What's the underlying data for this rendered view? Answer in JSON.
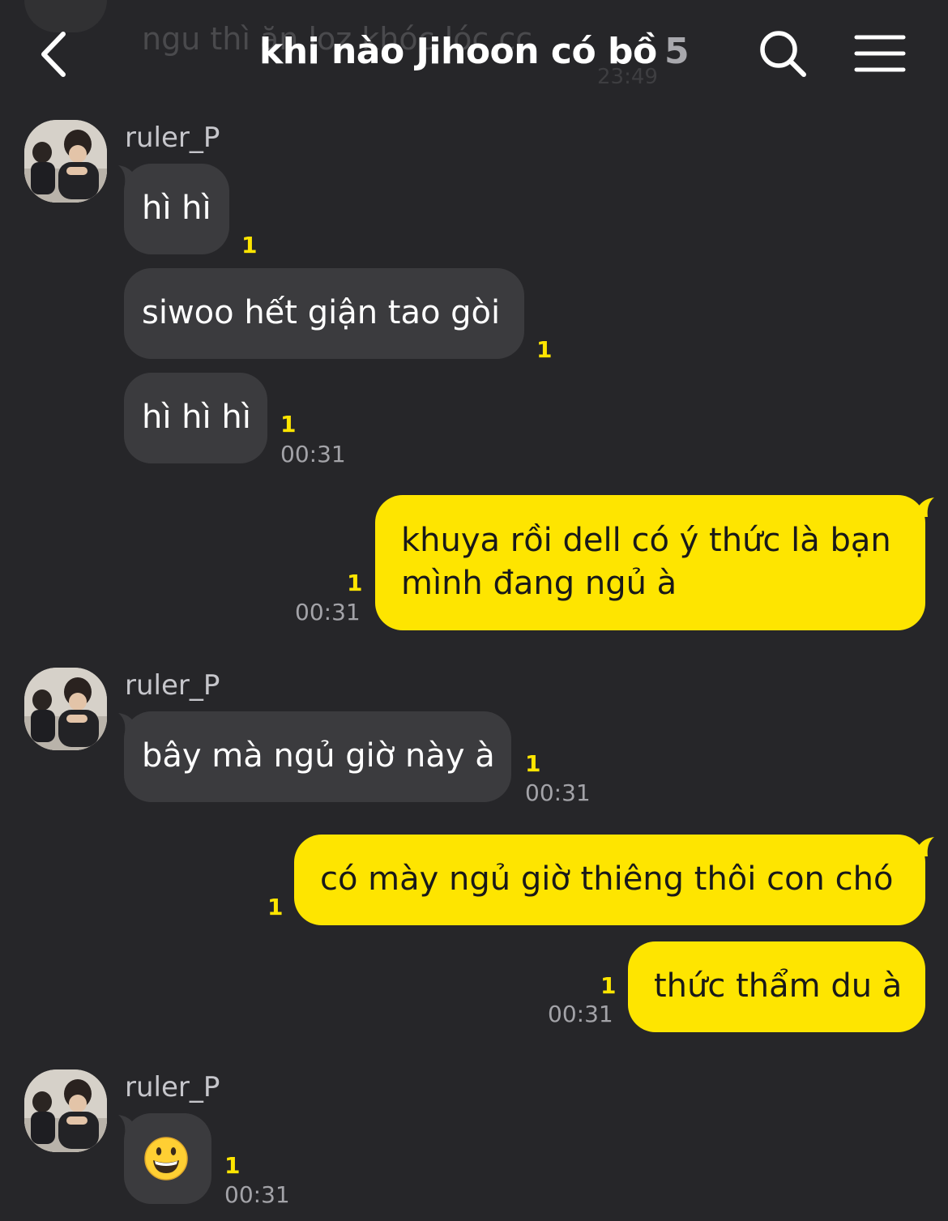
{
  "header": {
    "title": "khi nào Jihoon có bồ",
    "member_count": "5",
    "behind_text": "ngu thì ăn loz khóc lóc cc",
    "behind_time": "23:49"
  },
  "colors": {
    "background": "#262629",
    "incoming_bubble": "#3b3b3e",
    "outgoing_bubble": "#fee500",
    "unread_count": "#fee500"
  },
  "messages": [
    {
      "direction": "in",
      "sender": "ruler_P",
      "text": "hì hì",
      "unread": "1",
      "time": ""
    },
    {
      "direction": "in",
      "text": "siwoo hết giận tao gòi",
      "unread": "1",
      "time": ""
    },
    {
      "direction": "in",
      "text": "hì hì hì",
      "unread": "1",
      "time": "00:31"
    },
    {
      "direction": "out",
      "lines": [
        "khuya rồi dell có ý thức là bạn",
        "mình đang ngủ à"
      ],
      "unread": "1",
      "time": "00:31"
    },
    {
      "direction": "in",
      "sender": "ruler_P",
      "text": "bây mà ngủ giờ này à",
      "unread": "1",
      "time": "00:31"
    },
    {
      "direction": "out",
      "text": "có mày ngủ giờ thiêng thôi con chó",
      "unread": "1",
      "time": ""
    },
    {
      "direction": "out",
      "text": "thức thẩm du à",
      "unread": "1",
      "time": "00:31"
    },
    {
      "direction": "in",
      "sender": "ruler_P",
      "emoji": "grinning-face-emoji",
      "unread": "1",
      "time": "00:31"
    }
  ]
}
